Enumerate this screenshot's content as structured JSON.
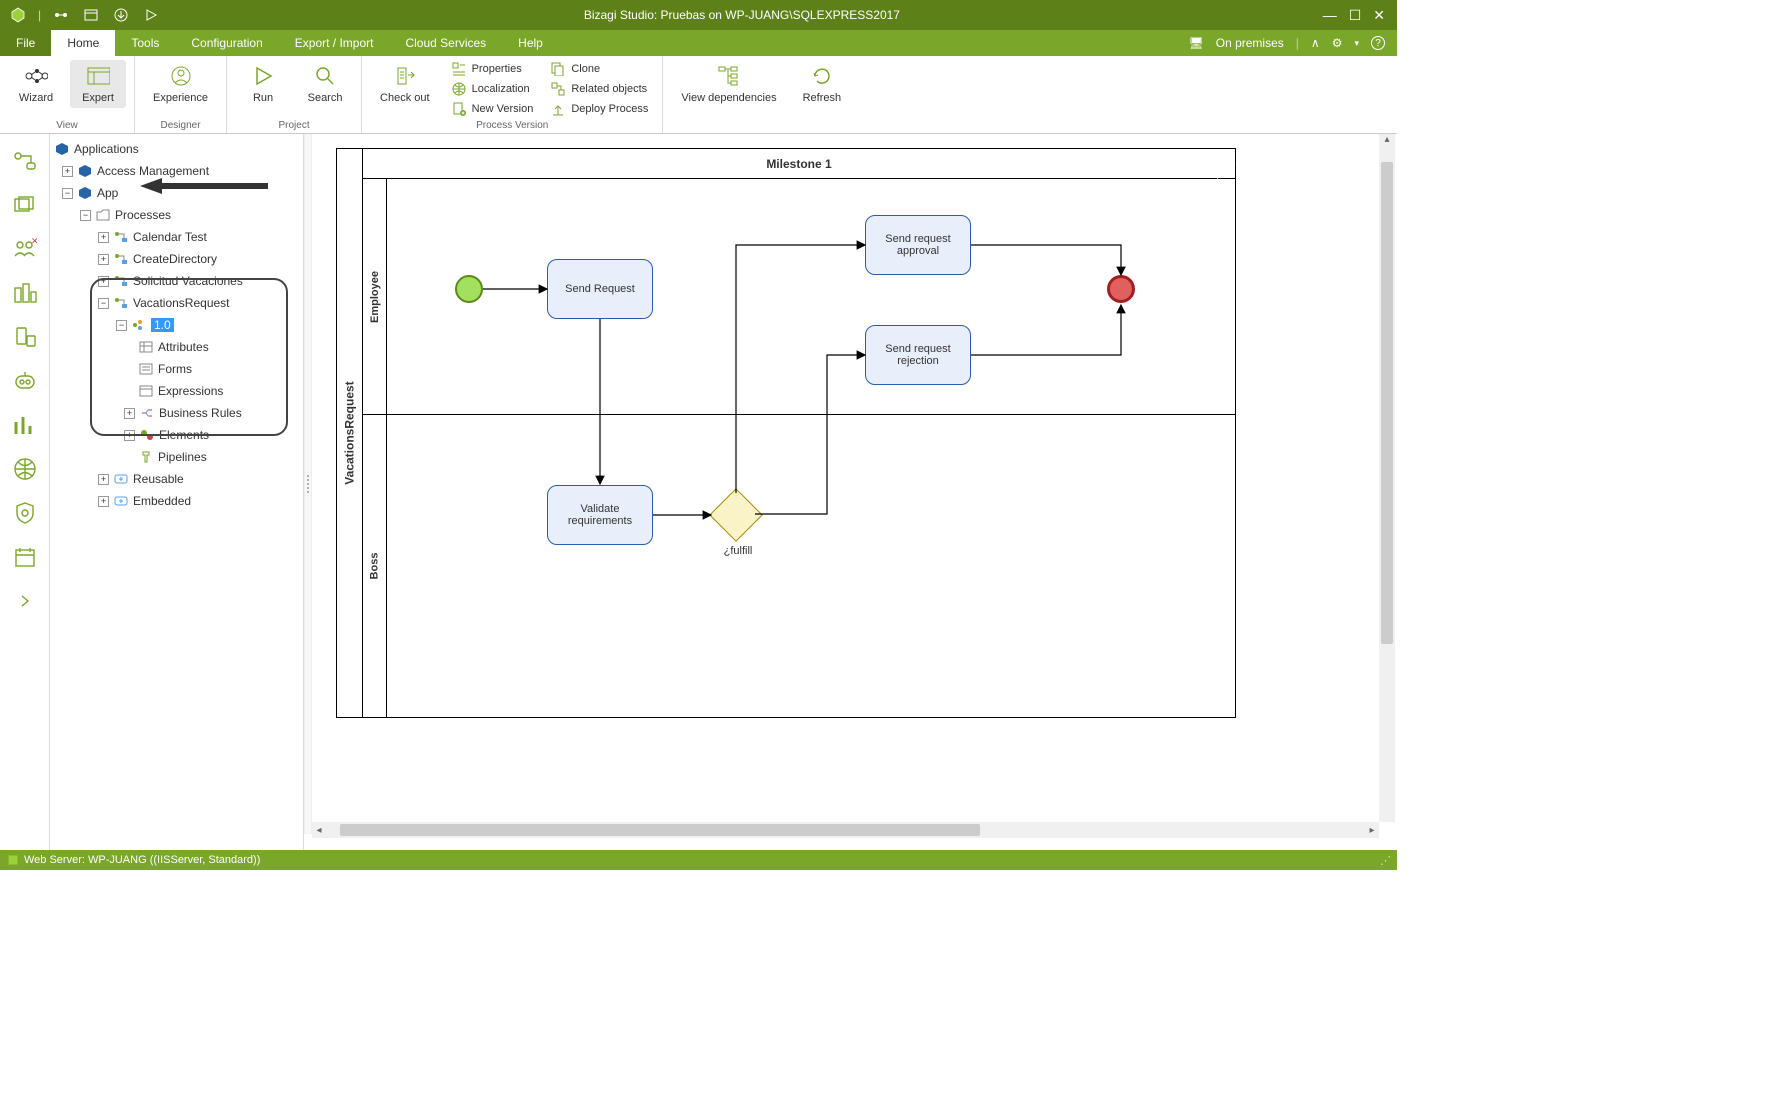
{
  "titleBar": {
    "title": "Bizagi Studio: Pruebas  on WP-JUANG\\SQLEXPRESS2017"
  },
  "menu": {
    "file": "File",
    "home": "Home",
    "tools": "Tools",
    "configuration": "Configuration",
    "exportImport": "Export / Import",
    "cloudServices": "Cloud Services",
    "help": "Help",
    "onPremises": "On premises"
  },
  "ribbon": {
    "view": {
      "wizard": "Wizard",
      "expert": "Expert",
      "label": "View"
    },
    "designer": {
      "experience": "Experience",
      "label": "Designer"
    },
    "project": {
      "run": "Run",
      "search": "Search",
      "label": "Project"
    },
    "processVersion": {
      "checkOut": "Check out",
      "properties": "Properties",
      "localization": "Localization",
      "newVersion": "New Version",
      "clone": "Clone",
      "relatedObjects": "Related objects",
      "deployProcess": "Deploy Process",
      "label": "Process Version"
    },
    "deps": {
      "viewDependencies": "View dependencies",
      "refresh": "Refresh"
    }
  },
  "tree": {
    "root": "Applications",
    "items": {
      "accessMgmt": "Access Management",
      "app": "App",
      "processes": "Processes",
      "calendarTest": "Calendar Test",
      "createDirectory": "CreateDirectory",
      "solicitudVacaciones": "Solicitud Vacaciones",
      "vacationsRequest": "VacationsRequest",
      "v10": "1.0",
      "attributes": "Attributes",
      "forms": "Forms",
      "expressions": "Expressions",
      "businessRules": "Business Rules",
      "elements": "Elements",
      "pipelines": "Pipelines",
      "reusable": "Reusable",
      "embedded": "Embedded"
    }
  },
  "diagram": {
    "pool": "VacationsRequest",
    "milestone": "Milestone 1",
    "lanes": {
      "employee": "Employee",
      "boss": "Boss"
    },
    "tasks": {
      "sendRequest": "Send Request",
      "sendApproval": "Send request approval",
      "sendRejection": "Send request rejection",
      "validate": "Validate requirements"
    },
    "gatewayLabel": "¿fulfill"
  },
  "status": {
    "text": "Web Server: WP-JUANG ((IISServer, Standard))"
  }
}
